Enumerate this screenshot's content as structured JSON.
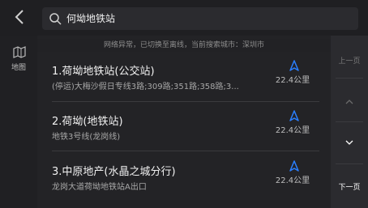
{
  "header": {
    "back_label": "<",
    "search_value": "何坳地铁站"
  },
  "left_nav": {
    "map_label": "地图"
  },
  "notice": "网络异常，已切换至离线，当前搜索城市：深圳市",
  "results": [
    {
      "title": "1.荷坳地铁站(公交站)",
      "subtitle": "(停运)大梅沙假日专线3路;309路;351路;358路;3...",
      "distance": "22.4公里"
    },
    {
      "title": "2.荷坳(地铁站)",
      "subtitle": "地铁3号线(龙岗线)",
      "distance": "22.4公里"
    },
    {
      "title": "3.中原地产(水晶之城分行)",
      "subtitle": "龙岗大道荷坳地铁站A出口",
      "distance": "22.4公里"
    }
  ],
  "pager": {
    "prev_label": "上一页",
    "next_label": "下一页"
  },
  "colors": {
    "accent_blue": "#2a7fff",
    "background": "#1c1c1e"
  }
}
